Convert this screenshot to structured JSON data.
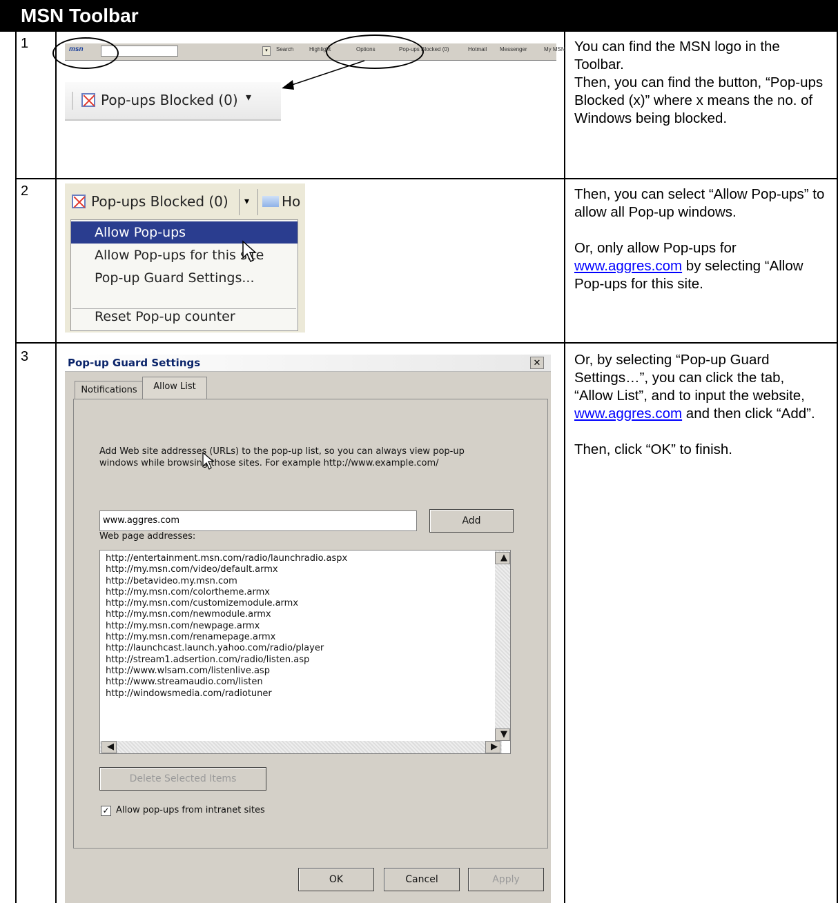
{
  "header": {
    "title": "MSN Toolbar"
  },
  "steps": [
    {
      "number": "1",
      "toolbar": {
        "logo": "msn",
        "items": [
          "Search",
          "Highlight",
          "Options",
          "Pop-ups Blocked (0)",
          "Hotmail",
          "Messenger",
          "My MSN"
        ]
      },
      "zoom_label": "Pop-ups Blocked (0)",
      "desc": {
        "p1": "You can find the MSN logo in the Toolbar.",
        "p2": "Then, you can find the button, “Pop-ups Blocked (x)” where x means the no. of Windows being blocked."
      }
    },
    {
      "number": "2",
      "button_label": "Pop-ups Blocked (0)",
      "button_next": "Ho",
      "menu": [
        "Allow Pop-ups",
        "Allow Pop-ups for this site",
        "Pop-up Guard Settings...",
        "Reset Pop-up counter"
      ],
      "desc": {
        "p1": "Then, you can select “Allow Pop-ups” to allow all Pop-up windows.",
        "p2a": "Or, only allow Pop-ups for ",
        "p2link": "www.aggres.com",
        "p2b": " by selecting “Allow Pop-ups for this site."
      }
    },
    {
      "number": "3",
      "dialog": {
        "title": "Pop-up Guard Settings",
        "tab_notifications": "Notifications",
        "tab_allow": "Allow List",
        "instructions_1": "Add Web site addresses (URLs) to the pop-up list, so you can always view pop-up",
        "instructions_2": "windows while browsing those sites. For example http://www.example.com/",
        "input_value": "www.aggres.com",
        "add_label": "Add",
        "list_label": "Web page addresses:",
        "urls": [
          "http://entertainment.msn.com/radio/launchradio.aspx",
          "http://my.msn.com/video/default.armx",
          "http://betavideo.my.msn.com",
          "http://my.msn.com/colortheme.armx",
          "http://my.msn.com/customizemodule.armx",
          "http://my.msn.com/newmodule.armx",
          "http://my.msn.com/newpage.armx",
          "http://my.msn.com/renamepage.armx",
          "http://launchcast.launch.yahoo.com/radio/player",
          "http://stream1.adsertion.com/radio/listen.asp",
          "http://www.wlsam.com/listenlive.asp",
          "http://www.streamaudio.com/listen",
          "http://windowsmedia.com/radiotuner"
        ],
        "delete_label": "Delete Selected Items",
        "checkbox_label": "Allow pop-ups from intranet sites",
        "checkbox_checked": true,
        "ok_label": "OK",
        "cancel_label": "Cancel",
        "apply_label": "Apply"
      },
      "desc": {
        "p1a": "Or, by selecting “Pop-up Guard Settings…”, you can click the tab, “Allow List”, and to input the website, ",
        "p1link": "www.aggres.com",
        "p1b": " and then click “Add”.",
        "p2": "Then, click “OK” to finish."
      }
    }
  ]
}
